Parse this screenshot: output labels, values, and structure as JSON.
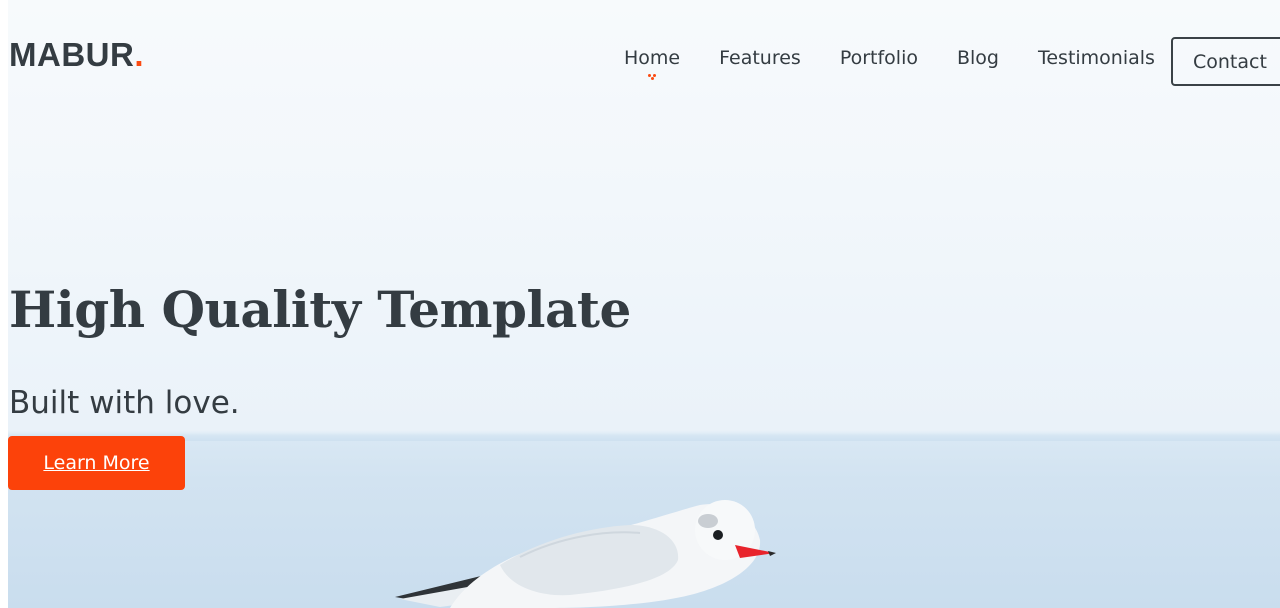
{
  "brand": {
    "name": "MABUR",
    "dot": ".",
    "accent_color": "#fb4b12"
  },
  "nav": {
    "items": [
      {
        "label": "Home",
        "active": true
      },
      {
        "label": "Features"
      },
      {
        "label": "Portfolio"
      },
      {
        "label": "Blog"
      },
      {
        "label": "Testimonials"
      }
    ],
    "contact_label": "Contact"
  },
  "hero": {
    "title": "High Quality Template",
    "subtitle": "Built with love.",
    "cta_label": "Learn More",
    "cta_color": "#fc420a",
    "image_subject": "seagull-by-sea"
  }
}
